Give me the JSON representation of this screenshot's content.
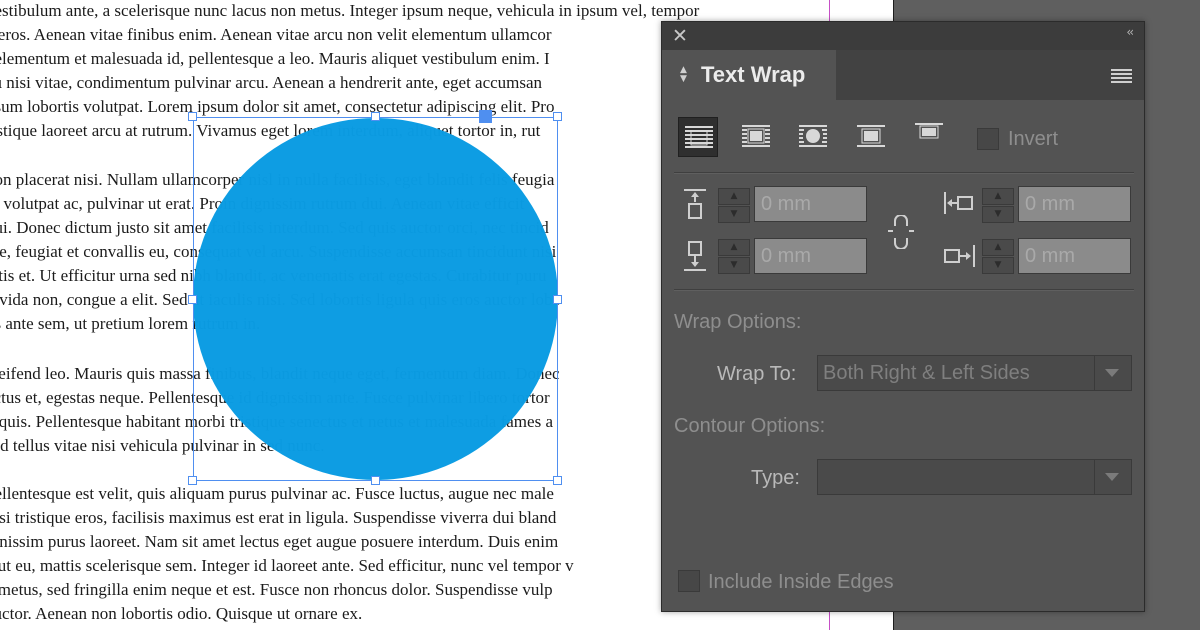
{
  "document": {
    "lines": [
      "vestibulum ante, a scelerisque nunc lacus non metus. Integer ipsum neque, vehicula in ipsum vel, tempor",
      "e eros. Aenean vitae finibus enim. Aenean vitae arcu non velit elementum ullamcor",
      ", elementum et malesuada id, pellentesque a leo. Mauris aliquet vestibulum enim. I",
      "eu nisi vitae, condimentum pulvinar arcu. Aenean a hendrerit ante, eget accumsan",
      "psum lobortis volutpat. Lorem ipsum dolor sit amet, consectetur adipiscing elit. Pro",
      "ristique laoreet arcu at rutrum. Vivamus eget lorem interdum, aliquet tortor in, rut",
      "",
      "non placerat nisi. Nullam ullamcorper nisl in nulla facilisis, eget blandit felis feugia",
      "id volutpat ac, pulvinar ut erat. Proin dignissim rutrum dui. Aenean vitae efficit",
      "dui. Donec dictum justo sit amet facilisis interdum. Sed quis auctor orci, nec tincid",
      "nte, feugiat et convallis eu, consequat vel arcu. Suspendisse accumsan tincidunt nisi",
      "attis et. Ut efficitur urna sed nibh blandit, ac venenatis erat egestas. Curabitur puru",
      "ravida non, congue a elit. Sed at iaculis nisi. Sed lobortis ligula quis eros auctor lobo",
      "us ante sem, ut pretium lorem rutrum in.",
      "",
      "eleifend leo. Mauris quis massa finibus, blandit neque eget, fermentum diam. Donec",
      "ectus et, egestas neque. Pellentesque id dignissim ante. Fusce pulvinar libero tortor",
      "n quis. Pellentesque habitant morbi tristique senectus et netus et malesuada fames a",
      "sed tellus vitae nisi vehicula pulvinar in sed nunc.",
      "",
      "pellentesque est velit, quis aliquam purus pulvinar ac. Fusce luctus, augue nec male",
      "nisi tristique eros, facilisis maximus est erat in ligula. Suspendisse viverra dui bland",
      "ignissim purus laoreet. Nam sit amet lectus eget augue posuere interdum. Duis enim",
      "a ut eu, mattis scelerisque sem. Integer id laoreet ante. Sed efficitur, nunc vel tempor v",
      "a metus, sed fringilla enim neque et est. Fusce non rhoncus dolor. Suspendisse vulp",
      "auctor. Aenean non lobortis odio. Quisque ut ornare ex."
    ],
    "shape_color": "#0a9be3",
    "selection_color": "#4f8ff0",
    "guide_color": "#c64fc6"
  },
  "panel": {
    "close_icon": "close-icon",
    "collapse_icon": "collapse-icon",
    "close_glyph": "✕",
    "collapse_glyph": "‹‹",
    "title": "Text Wrap",
    "menu_icon": "panel-menu-icon",
    "wrap_modes": [
      {
        "name": "no-text-wrap",
        "active": true
      },
      {
        "name": "wrap-around-bounding-box",
        "active": false
      },
      {
        "name": "wrap-around-object-shape",
        "active": false
      },
      {
        "name": "jump-object",
        "active": false
      },
      {
        "name": "jump-to-next-column",
        "active": false
      }
    ],
    "invert_label": "Invert",
    "offsets": {
      "top": "0 mm",
      "bottom": "0 mm",
      "left": "0 mm",
      "right": "0 mm"
    },
    "wrap_options_label": "Wrap Options:",
    "wrap_to_label": "Wrap To:",
    "wrap_to_value": "Both Right & Left Sides",
    "contour_options_label": "Contour Options:",
    "type_label": "Type:",
    "type_value": "",
    "include_inside_edges_label": "Include Inside Edges"
  }
}
